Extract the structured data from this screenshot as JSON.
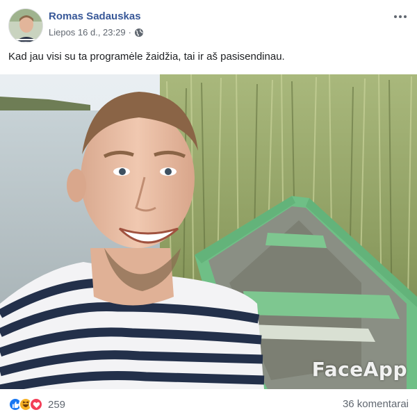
{
  "post": {
    "author": "Romas Sadauskas",
    "timestamp": "Liepos 16 d., 23:29",
    "separator": "·",
    "privacy_icon": "globe-icon",
    "more_icon": "more-options-icon",
    "text": "Kad jau visi su ta programėle žaidžia, tai ir aš pasisendinau.",
    "photo": {
      "watermark": "FaceApp"
    }
  },
  "footer": {
    "reaction_icons": [
      "like-icon",
      "haha-icon",
      "love-icon"
    ],
    "reaction_count": "259",
    "comments": "36 komentarai"
  },
  "colors": {
    "author_link": "#385898",
    "meta_text": "#606770",
    "like": "#1877f2",
    "haha": "#f7b125",
    "love": "#f33e58"
  }
}
